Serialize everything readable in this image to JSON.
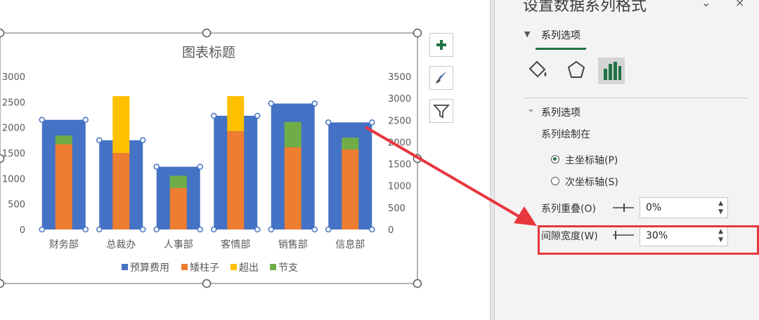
{
  "pane": {
    "title": "设置数据系列格式",
    "tab_label": "系列选项",
    "section_title": "系列选项",
    "plot_on_label": "系列绘制在",
    "radio_primary": "主坐标轴(P)",
    "radio_secondary": "次坐标轴(S)",
    "overlap_label": "系列重叠(O)",
    "overlap_value": "0%",
    "gap_label": "间隙宽度(W)",
    "gap_value": "30%",
    "icons": [
      "fill-bucket-icon",
      "pentagon-icon",
      "bar-chart-icon"
    ]
  },
  "chart_side_buttons": [
    "plus-icon",
    "brush-icon",
    "filter-icon"
  ],
  "chart_data": {
    "type": "bar",
    "title": "图表标题",
    "categories": [
      "财务部",
      "总裁办",
      "人事部",
      "客情部",
      "销售部",
      "信息部"
    ],
    "primary_axis": {
      "ticks": [
        "3000",
        "2500",
        "2000",
        "1500",
        "1000",
        "500",
        "0"
      ],
      "ylim": [
        0,
        3000
      ]
    },
    "secondary_axis": {
      "ticks": [
        "3500",
        "3000",
        "2500",
        "2000",
        "1500",
        "1000",
        "500",
        "0"
      ],
      "ylim": [
        0,
        3500
      ]
    },
    "series": [
      {
        "name": "预算费用",
        "color": "#4472c4",
        "axis": "primary",
        "values": [
          2150,
          1750,
          1230,
          2230,
          2470,
          2100
        ]
      },
      {
        "name": "矮柱子",
        "color": "#ed7d31",
        "axis": "secondary",
        "stacked": true,
        "values": [
          1950,
          1750,
          950,
          2250,
          1880,
          1830
        ]
      },
      {
        "name": "超出",
        "color": "#ffc000",
        "axis": "secondary",
        "stacked": true,
        "values": [
          0,
          1300,
          0,
          800,
          0,
          0
        ]
      },
      {
        "name": "节支",
        "color": "#70ad47",
        "axis": "secondary",
        "stacked": true,
        "values": [
          200,
          0,
          280,
          0,
          580,
          270
        ]
      }
    ],
    "legend": "bottom",
    "grid": false
  }
}
